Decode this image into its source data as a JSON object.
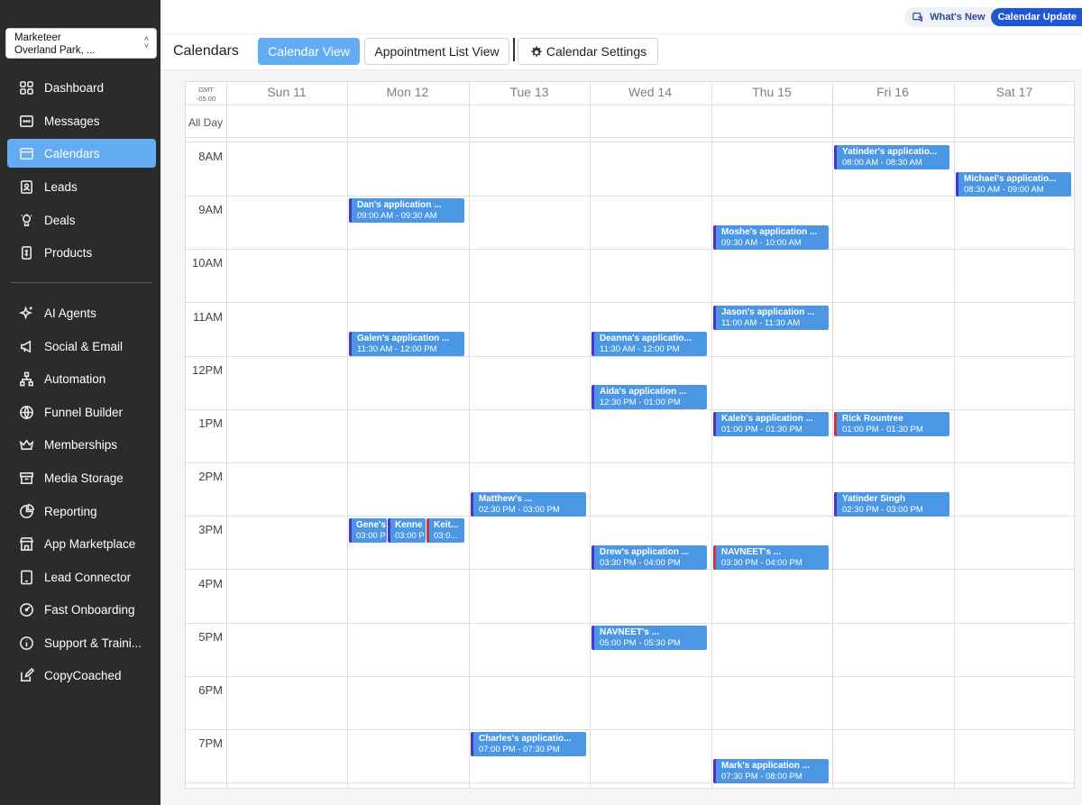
{
  "location": {
    "name": "Marketeer",
    "address": "Overland Park, ..."
  },
  "nav": {
    "primary": [
      {
        "label": "Dashboard",
        "icon": "dashboard-icon"
      },
      {
        "label": "Messages",
        "icon": "messages-icon"
      },
      {
        "label": "Calendars",
        "icon": "calendar-icon",
        "active": true
      },
      {
        "label": "Leads",
        "icon": "contacts-icon"
      },
      {
        "label": "Deals",
        "icon": "deals-icon"
      },
      {
        "label": "Products",
        "icon": "products-icon"
      }
    ],
    "secondary": [
      {
        "label": "AI Agents",
        "icon": "sparkle-icon"
      },
      {
        "label": "Social & Email",
        "icon": "megaphone-icon"
      },
      {
        "label": "Automation",
        "icon": "automation-icon"
      },
      {
        "label": "Funnel Builder",
        "icon": "globe-icon"
      },
      {
        "label": "Memberships",
        "icon": "crown-icon"
      },
      {
        "label": "Media Storage",
        "icon": "archive-icon"
      },
      {
        "label": "Reporting",
        "icon": "pie-chart-icon"
      },
      {
        "label": "App Marketplace",
        "icon": "store-icon"
      },
      {
        "label": "Lead Connector",
        "icon": "tablet-icon"
      },
      {
        "label": "Fast Onboarding",
        "icon": "speedometer-icon"
      },
      {
        "label": "Support & Traini...",
        "icon": "info-icon"
      },
      {
        "label": "CopyCoached",
        "icon": "edit-icon"
      }
    ]
  },
  "topbar": {
    "whats_new": "What's New",
    "update_pill": "Calendar Update"
  },
  "header": {
    "title": "Calendars",
    "tabs": {
      "calendar_view": "Calendar View",
      "list_view": "Appointment List View",
      "settings": "Calendar Settings"
    }
  },
  "calendar": {
    "timezone_line1": "GMT",
    "timezone_line2": "-05:00",
    "all_day": "All Day",
    "days": [
      "Sun 11",
      "Mon 12",
      "Tue 13",
      "Wed 14",
      "Thu 15",
      "Fri 16",
      "Sat 17"
    ],
    "hours": [
      "8AM",
      "9AM",
      "10AM",
      "11AM",
      "12PM",
      "1PM",
      "2PM",
      "3PM",
      "4PM",
      "5PM",
      "6PM",
      "7PM"
    ],
    "events": [
      {
        "day": 5,
        "start": 8.0,
        "title": "Yatinder's applicatio...",
        "time": "08:00 AM - 08:30 AM",
        "color": "blue"
      },
      {
        "day": 6,
        "start": 8.5,
        "title": "Michael's applicatio...",
        "time": "08:30 AM - 09:00 AM",
        "color": "blue"
      },
      {
        "day": 1,
        "start": 9.0,
        "title": "Dan's application ...",
        "time": "09:00 AM - 09:30 AM",
        "color": "blue"
      },
      {
        "day": 4,
        "start": 9.5,
        "title": "Moshe's application ...",
        "time": "09:30 AM - 10:00 AM",
        "color": "blue"
      },
      {
        "day": 4,
        "start": 11.0,
        "title": "Jason's application ...",
        "time": "11:00 AM - 11:30 AM",
        "color": "blue"
      },
      {
        "day": 1,
        "start": 11.5,
        "title": "Galen's application ...",
        "time": "11:30 AM - 12:00 PM",
        "color": "blue"
      },
      {
        "day": 3,
        "start": 11.5,
        "title": "Deanna's applicatio...",
        "time": "11:30 AM - 12:00 PM",
        "color": "blue"
      },
      {
        "day": 3,
        "start": 12.5,
        "title": "Aida's application ...",
        "time": "12:30 PM - 01:00 PM",
        "color": "blue"
      },
      {
        "day": 4,
        "start": 13.0,
        "title": "Kaleb's application ...",
        "time": "01:00 PM - 01:30 PM",
        "color": "blue"
      },
      {
        "day": 5,
        "start": 13.0,
        "title": "Rick  Rountree",
        "time": "01:00 PM - 01:30 PM",
        "color": "red"
      },
      {
        "day": 2,
        "start": 14.5,
        "title": "Matthew's ...",
        "time": "02:30 PM - 03:00 PM",
        "color": "blue"
      },
      {
        "day": 5,
        "start": 14.5,
        "title": "Yatinder Singh",
        "time": "02:30 PM - 03:00 PM",
        "color": "blue"
      },
      {
        "day": 1,
        "start": 15.0,
        "sub": 0,
        "title": "Gene's",
        "time": "03:00 P",
        "color": "blue",
        "narrow": true
      },
      {
        "day": 1,
        "start": 15.0,
        "sub": 1,
        "title": "Kenne",
        "time": "03:00 P",
        "color": "blue",
        "narrow": true
      },
      {
        "day": 1,
        "start": 15.0,
        "sub": 2,
        "title": "Keit...",
        "time": "03:0...",
        "color": "red",
        "narrow": true
      },
      {
        "day": 3,
        "start": 15.5,
        "title": "Drew's application ...",
        "time": "03:30 PM - 04:00 PM",
        "color": "blue"
      },
      {
        "day": 4,
        "start": 15.5,
        "title": "NAVNEET's ...",
        "time": "03:30 PM - 04:00 PM",
        "color": "red"
      },
      {
        "day": 3,
        "start": 17.0,
        "title": "NAVNEET's ...",
        "time": "05:00 PM - 05:30 PM",
        "color": "blue"
      },
      {
        "day": 2,
        "start": 19.0,
        "title": "Charles's applicatio...",
        "time": "07:00 PM - 07:30 PM",
        "color": "blue"
      },
      {
        "day": 4,
        "start": 19.5,
        "title": "Mark's application ...",
        "time": "07:30 PM - 08:00 PM",
        "color": "blue"
      }
    ]
  },
  "colors": {
    "sidebar_bg": "#2b2b2b",
    "accent": "#63acf3",
    "event_bg": "#4c97e3",
    "event_border_blue": "#4a35c9",
    "event_border_red": "#c7354b"
  }
}
